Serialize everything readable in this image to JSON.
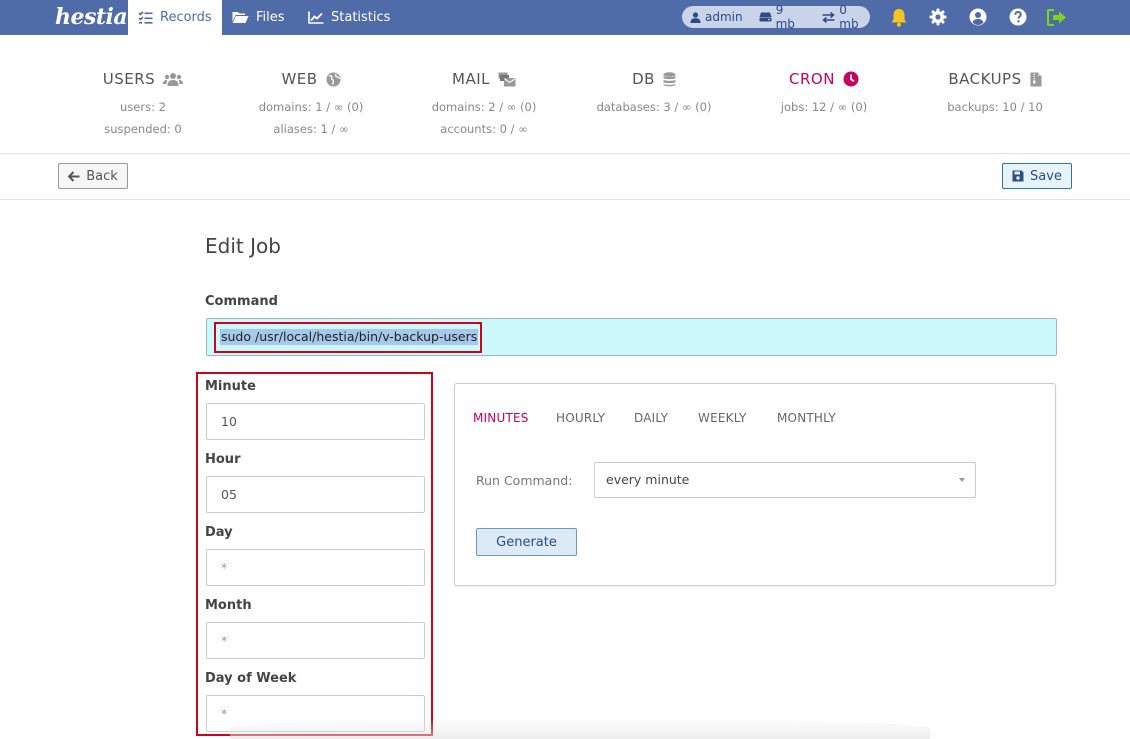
{
  "topbar": {
    "logo": "hestia",
    "nav": [
      {
        "label": "Records",
        "icon": "list-check-icon",
        "active": true
      },
      {
        "label": "Files",
        "icon": "folder-open-icon"
      },
      {
        "label": "Statistics",
        "icon": "chart-line-icon"
      }
    ],
    "user": {
      "name": "admin",
      "disk": "9 mb",
      "bandwidth": "0 mb"
    }
  },
  "stats": [
    {
      "title": "USERS",
      "icon": "users-icon",
      "lines": [
        "users: 2",
        "suspended: 0"
      ]
    },
    {
      "title": "WEB",
      "icon": "globe-icon",
      "lines": [
        "domains: 1 / ∞ (0)",
        "aliases: 1 / ∞"
      ]
    },
    {
      "title": "MAIL",
      "icon": "mail-bulk-icon",
      "lines": [
        "domains: 2 / ∞ (0)",
        "accounts: 0 / ∞"
      ]
    },
    {
      "title": "DB",
      "icon": "database-icon",
      "lines": [
        "databases: 3 / ∞ (0)"
      ]
    },
    {
      "title": "CRON",
      "icon": "clock-icon",
      "active": true,
      "lines": [
        "jobs: 12 / ∞ (0)"
      ]
    },
    {
      "title": "BACKUPS",
      "icon": "file-archive-icon",
      "lines": [
        "backups: 10 / 10"
      ]
    }
  ],
  "toolbar": {
    "back_label": "Back",
    "save_label": "Save"
  },
  "form": {
    "title": "Edit Job",
    "command_label": "Command",
    "command_value": "sudo /usr/local/hestia/bin/v-backup-users",
    "fields": [
      {
        "label": "Minute",
        "value": "10"
      },
      {
        "label": "Hour",
        "value": "05"
      },
      {
        "label": "Day",
        "value": "*"
      },
      {
        "label": "Month",
        "value": "*"
      },
      {
        "label": "Day of Week",
        "value": "*"
      }
    ]
  },
  "generator": {
    "tabs": [
      "MINUTES",
      "HOURLY",
      "DAILY",
      "WEEKLY",
      "MONTHLY"
    ],
    "active_tab": "MINUTES",
    "run_label": "Run Command:",
    "run_value": "every minute",
    "generate_label": "Generate"
  },
  "colors": {
    "nav_bg": "#4f6ba8",
    "accent": "#c9005f",
    "highlight": "#d0021b"
  }
}
